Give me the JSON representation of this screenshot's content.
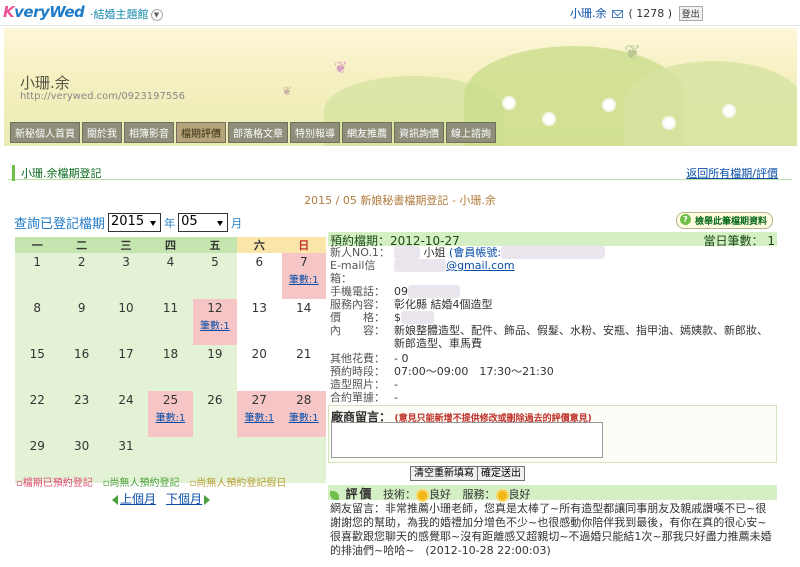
{
  "topbar": {
    "logo_k": "K",
    "logo_rest": "veryWed",
    "site_select": "‧結婚主題館",
    "user_name": "小珊.余",
    "mail_count": "( 1278 )",
    "logout": "登出"
  },
  "banner": {
    "owner_name": "小珊.余",
    "owner_url": "http://verywed.com/0923197556"
  },
  "nav": [
    {
      "label": "新秘個人首頁"
    },
    {
      "label": "關於我"
    },
    {
      "label": "相簿影音"
    },
    {
      "label": "檔期評價"
    },
    {
      "label": "部落格文章"
    },
    {
      "label": "特別報導"
    },
    {
      "label": "網友推薦"
    },
    {
      "label": "資訊詢價"
    },
    {
      "label": "線上諮詢"
    }
  ],
  "section": {
    "title": "小珊.余檔期登記",
    "back_link": "返回所有檔期/評價"
  },
  "month_title": "2015 / 05 新娘秘書檔期登記 - 小珊.余",
  "report_button": "檢舉此筆檔期資料",
  "query": {
    "label": "查詢已登記檔期",
    "year": "2015",
    "year_unit": "年",
    "month": "05",
    "month_unit": "月"
  },
  "calendar": {
    "weekdays": [
      "一",
      "二",
      "三",
      "四",
      "五",
      "六",
      "日"
    ],
    "count_label": "筆數:1",
    "weeks": [
      [
        {
          "d": "1"
        },
        {
          "d": "2"
        },
        {
          "d": "3"
        },
        {
          "d": "4"
        },
        {
          "d": "5"
        },
        {
          "d": "6"
        },
        {
          "d": "7",
          "booked": true
        }
      ],
      [
        {
          "d": "8"
        },
        {
          "d": "9"
        },
        {
          "d": "10"
        },
        {
          "d": "11"
        },
        {
          "d": "12",
          "booked": true
        },
        {
          "d": "13"
        },
        {
          "d": "14"
        }
      ],
      [
        {
          "d": "15"
        },
        {
          "d": "16"
        },
        {
          "d": "17"
        },
        {
          "d": "18"
        },
        {
          "d": "19"
        },
        {
          "d": "20"
        },
        {
          "d": "21"
        }
      ],
      [
        {
          "d": "22"
        },
        {
          "d": "23"
        },
        {
          "d": "24"
        },
        {
          "d": "25",
          "booked": true
        },
        {
          "d": "26"
        },
        {
          "d": "27",
          "booked": true
        },
        {
          "d": "28",
          "booked": true
        }
      ],
      [
        {
          "d": "29"
        },
        {
          "d": "30"
        },
        {
          "d": "31"
        },
        {
          "d": ""
        },
        {
          "d": ""
        },
        {
          "d": ""
        },
        {
          "d": ""
        }
      ]
    ]
  },
  "legend": {
    "booked": "▫檔期已預約登記",
    "free": "▫尚無人預約登記",
    "free_holiday": "▫尚無人預約登記假日"
  },
  "month_nav": {
    "prev": "上個月",
    "next": "下個月"
  },
  "detail": {
    "booking_date": "預約檔期：2012-10-27",
    "daily_count": "當日筆數： 1",
    "rows": {
      "bride_label": "新人NO.1：",
      "bride_suffix": "小姐",
      "bride_account_label": "(會員帳號:",
      "email_label": "E-mail信箱：",
      "email_visible": "@gmail.com",
      "phone_label": "手機電話：",
      "phone_visible": "09",
      "service_label": "服務內容：",
      "service_value": "彰化縣 結婚4個造型",
      "price_label": "價　　格：",
      "price_visible": "$",
      "content_label": "內　　容：",
      "content_value": "新娘整體造型、配件、飾品、假髮、水粉、安瓶、指甲油、嫣姨款、新郎妝、新郎造型、車馬費",
      "other_label": "其他花費：",
      "other_value": "- 0",
      "time_label": "預約時段：",
      "time_value": "07:00～09:00　17:30～21:30",
      "photo_label": "造型照片：",
      "photo_value": "-",
      "contract_label": "合約單據：",
      "contract_value": "-"
    },
    "message_label": "廠商留言：",
    "message_note": "(意見只能新增不提供修改或刪除過去的評價意見)",
    "reset_button": "清空重新填寫",
    "submit_button": "確定送出",
    "review_title": "評價",
    "skill_label": "技術：",
    "skill_value": "良好",
    "service_label": "服務：",
    "service_value": "良好",
    "review_text": "網友留言：非常推薦小珊老師，您真是太棒了~所有造型都讓同事朋友及親戚讚嘆不已~很謝謝您的幫助，為我的婚禮加分增色不少~也很感動你陪伴我到最後，有你在真的很心安~很喜歡跟您聊天的感覺耶~沒有距離感又超親切~不過婚只能結1次~那我只好盡力推薦未婚的排油們~哈哈~　(2012-10-28 22:00:03)"
  }
}
